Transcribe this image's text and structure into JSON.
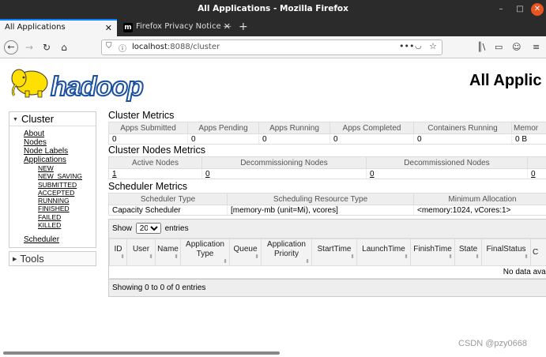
{
  "window": {
    "title": "All Applications - Mozilla Firefox",
    "minimize_glyph": "–",
    "maximize_glyph": "□",
    "close_glyph": "✕"
  },
  "tabs": [
    {
      "label": "All Applications",
      "close": "✕"
    },
    {
      "favicon": "m",
      "label": "Firefox Privacy Notice —",
      "close": "✕"
    }
  ],
  "new_tab_glyph": "+",
  "navbar": {
    "url_host": "localhost",
    "url_rest": ":8088/cluster",
    "icons": [
      "back-icon",
      "forward-icon",
      "reload-icon",
      "home-icon",
      "shield-icon",
      "info-icon",
      "page-actions-icon",
      "pocket-icon",
      "bookmark-star-icon",
      "library-icon",
      "sidebar-icon",
      "account-icon",
      "menu-icon"
    ]
  },
  "page": {
    "logo_text": "hadoop",
    "heading": "All Applic"
  },
  "sidebar": {
    "cluster_label": "Cluster",
    "links": [
      "About",
      "Nodes",
      "Node Labels",
      "Applications"
    ],
    "app_states": [
      "NEW",
      "NEW_SAVING",
      "SUBMITTED",
      "ACCEPTED",
      "RUNNING",
      "FINISHED",
      "FAILED",
      "KILLED"
    ],
    "scheduler": "Scheduler",
    "tools_label": "Tools"
  },
  "cluster_metrics": {
    "title": "Cluster Metrics",
    "headers": [
      "Apps Submitted",
      "Apps Pending",
      "Apps Running",
      "Apps Completed",
      "Containers Running",
      "Memor"
    ],
    "values": [
      "0",
      "0",
      "0",
      "0",
      "0",
      "0 B"
    ]
  },
  "nodes_metrics": {
    "title": "Cluster Nodes Metrics",
    "headers": [
      "Active Nodes",
      "Decommissioning Nodes",
      "Decommissioned Nodes",
      ""
    ],
    "values": [
      "1",
      "0",
      "0",
      "0"
    ]
  },
  "scheduler_metrics": {
    "title": "Scheduler Metrics",
    "headers": [
      "Scheduler Type",
      "Scheduling Resource Type",
      "Minimum Allocation"
    ],
    "values": [
      "Capacity Scheduler",
      "[memory-mb (unit=Mi), vcores]",
      "<memory:1024, vCores:1>"
    ]
  },
  "apps_table": {
    "show_label": "Show",
    "entries_label": "entries",
    "page_size": "20",
    "columns": [
      "ID",
      "User",
      "Name",
      "Application Type",
      "Queue",
      "Application Priority",
      "StartTime",
      "LaunchTime",
      "FinishTime",
      "State",
      "FinalStatus",
      "C"
    ],
    "empty_text": "No data availabl",
    "info": "Showing 0 to 0 of 0 entries"
  },
  "watermark": "CSDN @pzy0668",
  "colors": {
    "title_bg": "#2b2b2b",
    "accent": "#0a84ff",
    "close_btn": "#e95420",
    "logo_yellow": "#ffe000",
    "logo_blue": "#1a50a0"
  }
}
